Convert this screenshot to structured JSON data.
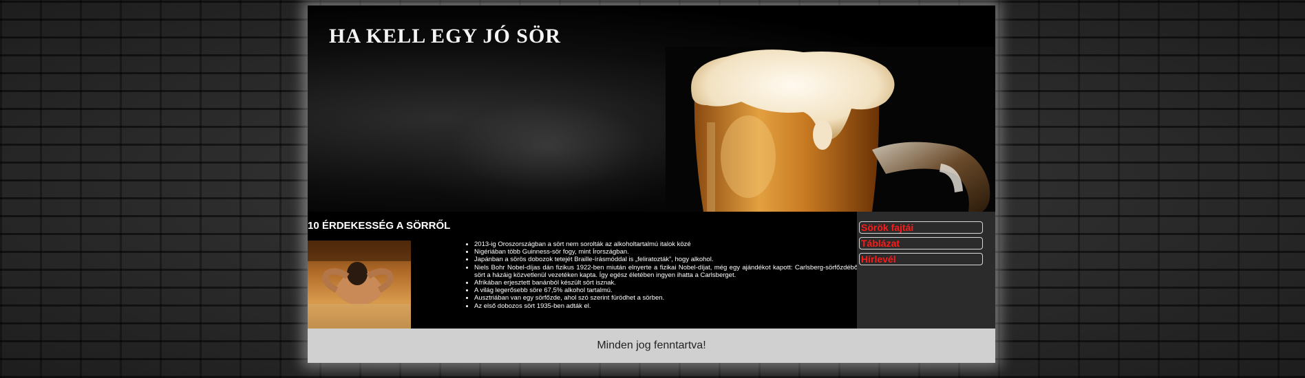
{
  "header": {
    "title": "HA KELL EGY JÓ SÖR"
  },
  "main": {
    "section_title": "10 ÉRDEKESSÉG A SÖRRŐL",
    "facts": [
      "2013-ig Oroszországban a sört nem sorolták az alkoholtartalmú italok közé",
      "Nigériában több Guinness-sör fogy, mint Írországban.",
      "Japánban a sörös dobozok tetejét Braille-írásmóddal is „feliratozták”, hogy alkohol.",
      "Niels Bohr Nobel-díjas dán fizikus 1922-ben miután elnyerte a fizikai Nobel-díjat, még egy ajándékot kapott: Carlsberg-sörfőzdéből a sört a házáig közvetlenül vezetéken kapta. Így egész életében ingyen ihatta a Carlsberget.",
      "Afrikában erjesztett banánból készült sört isznak.",
      "A világ legerősebb söre 67,5% alkohol tartalmú.",
      "Ausztriában van egy sörfőzde, ahol szó szerint fürödhet a sörben.",
      "Az első dobozos sört 1935-ben adták el."
    ]
  },
  "sidebar": {
    "links": [
      "Sörök fajtái",
      "Táblázat",
      "Hírlevél"
    ]
  },
  "footer": {
    "text": "Minden jog fenntartva!"
  },
  "colors": {
    "link_red": "#ff1a1a",
    "sidebar_bg": "#2b2b2b",
    "footer_bg": "#d0d0d0"
  }
}
